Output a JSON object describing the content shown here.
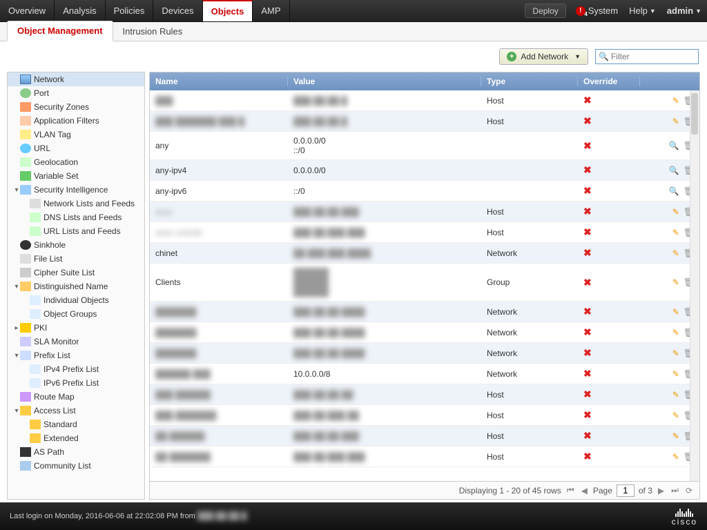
{
  "topmenu": {
    "items": [
      "Overview",
      "Analysis",
      "Policies",
      "Devices",
      "Objects",
      "AMP"
    ],
    "active": "Objects",
    "deploy": "Deploy",
    "system": "System",
    "help": "Help",
    "user": "admin"
  },
  "subtabs": {
    "items": [
      "Object Management",
      "Intrusion Rules"
    ],
    "active": "Object Management"
  },
  "toolbar": {
    "add_label": "Add Network",
    "filter_placeholder": "Filter"
  },
  "sidebar": [
    {
      "label": "Network",
      "icon": "ic-net",
      "sel": true,
      "ind": 0,
      "tri": ""
    },
    {
      "label": "Port",
      "icon": "ic-port",
      "ind": 0,
      "tri": ""
    },
    {
      "label": "Security Zones",
      "icon": "ic-zone",
      "ind": 0,
      "tri": ""
    },
    {
      "label": "Application Filters",
      "icon": "ic-app",
      "ind": 0,
      "tri": ""
    },
    {
      "label": "VLAN Tag",
      "icon": "ic-vlan",
      "ind": 0,
      "tri": ""
    },
    {
      "label": "URL",
      "icon": "ic-url",
      "ind": 0,
      "tri": ""
    },
    {
      "label": "Geolocation",
      "icon": "ic-geo",
      "ind": 0,
      "tri": ""
    },
    {
      "label": "Variable Set",
      "icon": "ic-var",
      "ind": 0,
      "tri": ""
    },
    {
      "label": "Security Intelligence",
      "icon": "ic-si",
      "ind": 0,
      "tri": "▾"
    },
    {
      "label": "Network Lists and Feeds",
      "icon": "ic-list",
      "ind": 1,
      "tri": ""
    },
    {
      "label": "DNS Lists and Feeds",
      "icon": "ic-dns",
      "ind": 1,
      "tri": ""
    },
    {
      "label": "URL Lists and Feeds",
      "icon": "ic-urlf",
      "ind": 1,
      "tri": ""
    },
    {
      "label": "Sinkhole",
      "icon": "ic-sink",
      "ind": 0,
      "tri": ""
    },
    {
      "label": "File List",
      "icon": "ic-list",
      "ind": 0,
      "tri": ""
    },
    {
      "label": "Cipher Suite List",
      "icon": "ic-cipher",
      "ind": 0,
      "tri": ""
    },
    {
      "label": "Distinguished Name",
      "icon": "ic-dn",
      "ind": 0,
      "tri": "▾"
    },
    {
      "label": "Individual Objects",
      "icon": "ic-obj",
      "ind": 1,
      "tri": ""
    },
    {
      "label": "Object Groups",
      "icon": "ic-grp",
      "ind": 1,
      "tri": ""
    },
    {
      "label": "PKI",
      "icon": "ic-pki",
      "ind": 0,
      "tri": "▸"
    },
    {
      "label": "SLA Monitor",
      "icon": "ic-sla",
      "ind": 0,
      "tri": ""
    },
    {
      "label": "Prefix List",
      "icon": "ic-prefix",
      "ind": 0,
      "tri": "▾"
    },
    {
      "label": "IPv4 Prefix List",
      "icon": "ic-obj",
      "ind": 1,
      "tri": ""
    },
    {
      "label": "IPv6 Prefix List",
      "icon": "ic-obj",
      "ind": 1,
      "tri": ""
    },
    {
      "label": "Route Map",
      "icon": "ic-route",
      "ind": 0,
      "tri": ""
    },
    {
      "label": "Access List",
      "icon": "ic-access",
      "ind": 0,
      "tri": "▾"
    },
    {
      "label": "Standard",
      "icon": "ic-std",
      "ind": 1,
      "tri": ""
    },
    {
      "label": "Extended",
      "icon": "ic-std",
      "ind": 1,
      "tri": ""
    },
    {
      "label": "AS Path",
      "icon": "ic-as",
      "ind": 0,
      "tri": ""
    },
    {
      "label": "Community List",
      "icon": "ic-comm",
      "ind": 0,
      "tri": ""
    }
  ],
  "table": {
    "headers": {
      "name": "Name",
      "value": "Value",
      "type": "Type",
      "override": "Override"
    },
    "rows": [
      {
        "name": "███",
        "value": "███.██.██.█",
        "type": "Host",
        "blur": true,
        "act": "edit"
      },
      {
        "name": "███ ███████ ███ █",
        "value": "███.██.██.█",
        "type": "Host",
        "blur": true,
        "act": "edit"
      },
      {
        "name": "any",
        "value": "0.0.0.0/0\n::/0",
        "type": "",
        "blur": false,
        "act": "view"
      },
      {
        "name": "any-ipv4",
        "value": "0.0.0.0/0",
        "type": "",
        "blur": false,
        "act": "view"
      },
      {
        "name": "any-ipv6",
        "value": "::/0",
        "type": "",
        "blur": false,
        "act": "view"
      },
      {
        "name": "asav",
        "value": "███.██.██.███",
        "type": "Host",
        "blur": true,
        "act": "edit",
        "nameclear": false
      },
      {
        "name": "asav-outside",
        "value": "███.██.███.███",
        "type": "Host",
        "blur": true,
        "act": "edit",
        "nameclear": false
      },
      {
        "name": "chinet",
        "value": "██.███.███.████",
        "type": "Network",
        "blur": true,
        "act": "edit",
        "nameclear": true
      },
      {
        "name": "Clients",
        "value": "██████\n██████\n██████",
        "type": "Group",
        "blur": true,
        "act": "edit",
        "nameclear": true
      },
      {
        "name": "███████",
        "value": "███.██.██.████",
        "type": "Network",
        "blur": true,
        "act": "edit"
      },
      {
        "name": "███████",
        "value": "███.██.██.████",
        "type": "Network",
        "blur": true,
        "act": "edit"
      },
      {
        "name": "███████",
        "value": "███.██.██.████",
        "type": "Network",
        "blur": true,
        "act": "edit"
      },
      {
        "name": "██████ ███",
        "value": "10.0.0.0/8",
        "type": "Network",
        "blur": true,
        "act": "edit",
        "valclear": true
      },
      {
        "name": "███ ██████",
        "value": "███.██.██.██",
        "type": "Host",
        "blur": true,
        "act": "edit"
      },
      {
        "name": "███ ███████",
        "value": "███.██.███.██",
        "type": "Host",
        "blur": true,
        "act": "edit"
      },
      {
        "name": "██ ██████",
        "value": "███.██.██.███",
        "type": "Host",
        "blur": true,
        "act": "edit"
      },
      {
        "name": "██ ███████",
        "value": "███.██.███.███",
        "type": "Host",
        "blur": true,
        "act": "edit"
      }
    ]
  },
  "pager": {
    "display": "Displaying 1 - 20 of 45 rows",
    "page_label": "Page",
    "page_value": "1",
    "of_label": "of 3"
  },
  "footer": {
    "lastlogin": "Last login on Monday, 2016-06-06 at 22:02:08 PM from",
    "brand": "cisco"
  }
}
